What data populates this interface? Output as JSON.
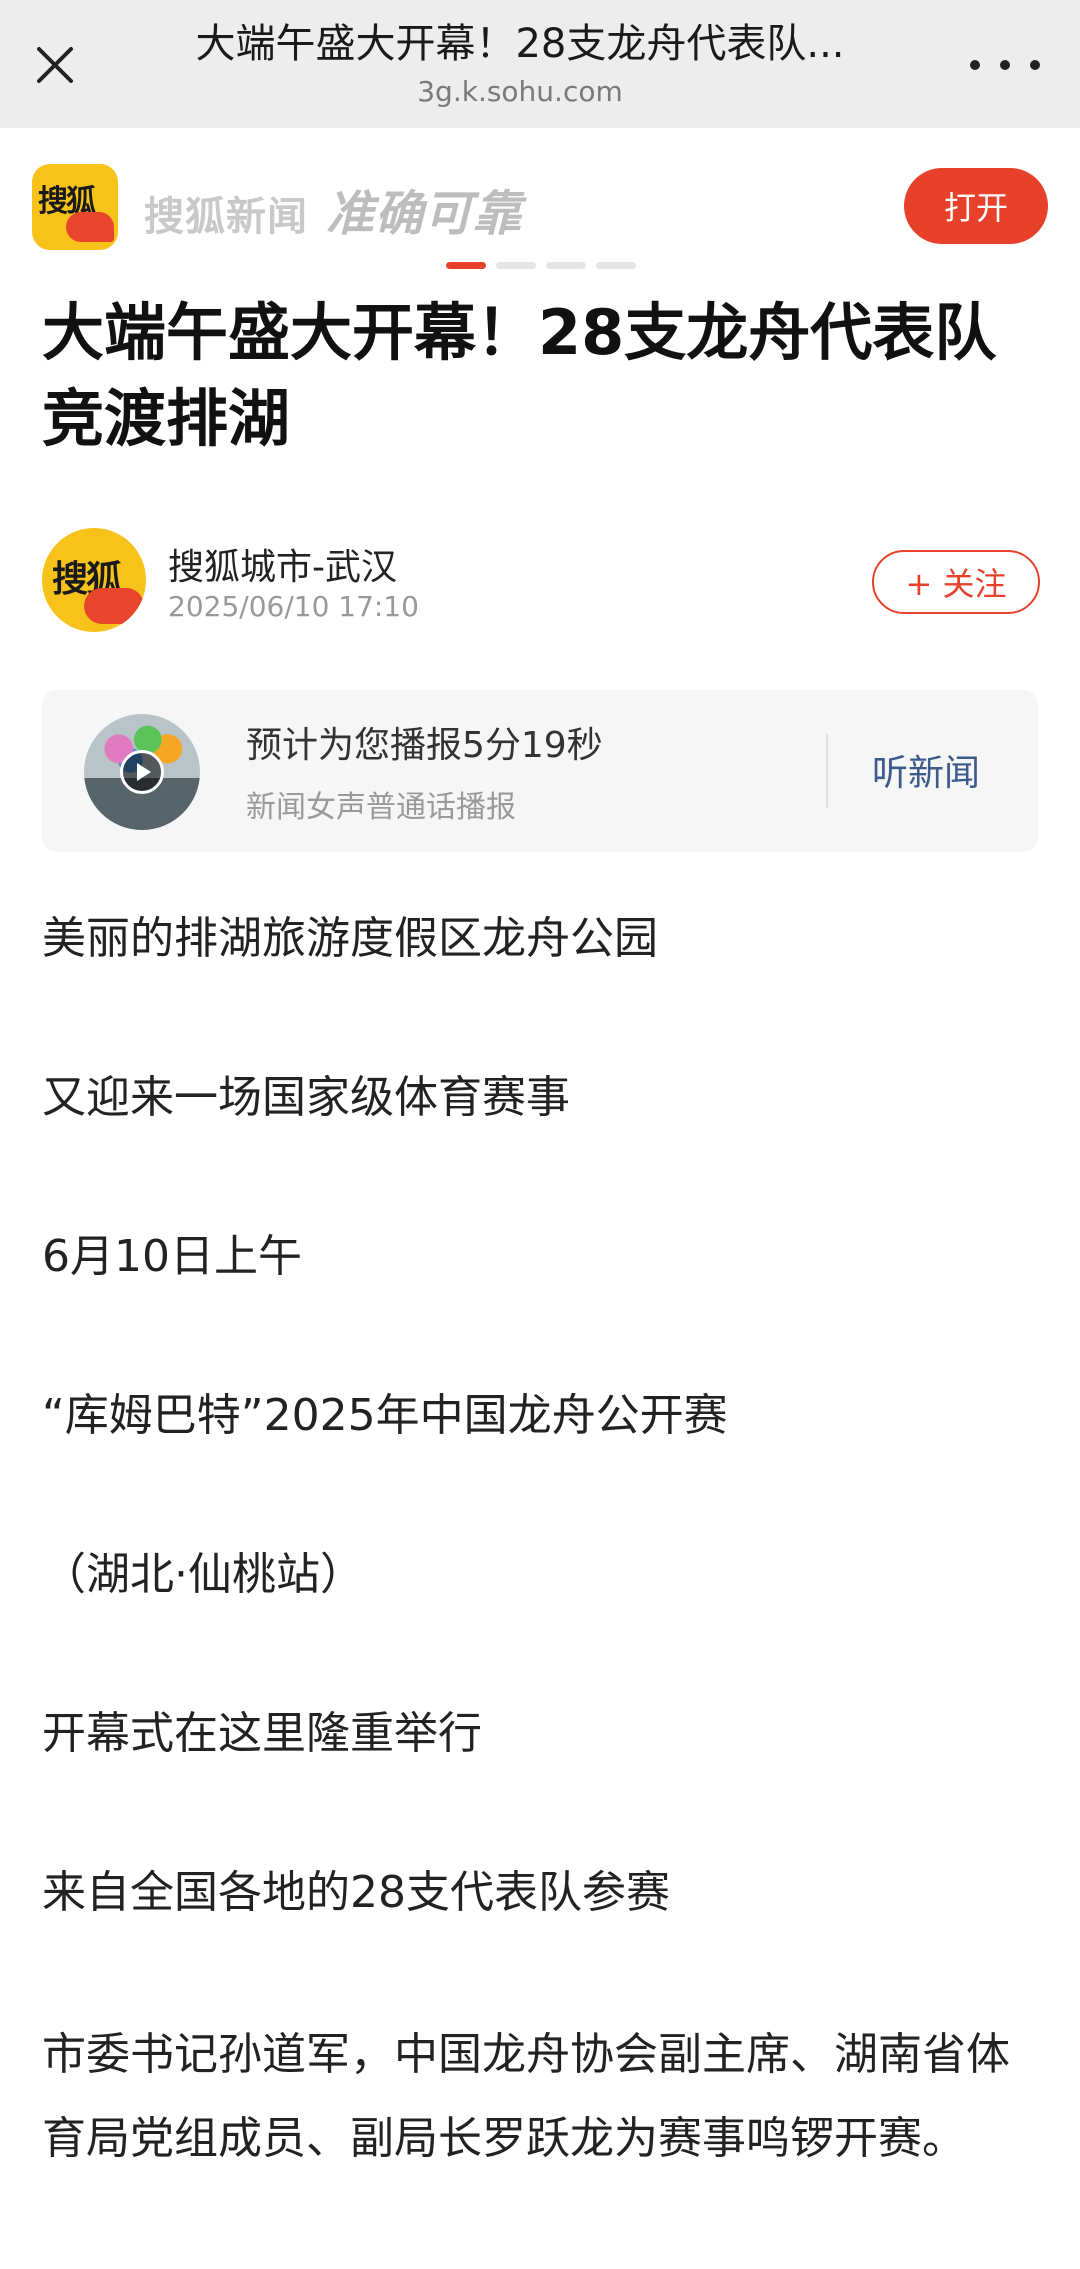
{
  "browser": {
    "title": "大端午盛大开幕！28支龙舟代表队...",
    "url": "3g.k.sohu.com"
  },
  "promo": {
    "logo_text": "搜狐",
    "app_name": "搜狐新闻",
    "slogan": "准确可靠",
    "open_label": "打开"
  },
  "article": {
    "headline": "大端午盛大开幕！28支龙舟代表队竞渡排湖",
    "author": {
      "name": "搜狐城市-武汉",
      "time": "2025/06/10 17:10",
      "avatar_text": "搜狐",
      "follow_label": "+ 关注"
    },
    "listen": {
      "main": "预计为您播报5分19秒",
      "sub": "新闻女声普通话播报",
      "button": "听新闻"
    },
    "paragraphs": [
      "美丽的排湖旅游度假区龙舟公园",
      "又迎来一场国家级体育赛事",
      "6月10日上午",
      "“库姆巴特”2025年中国龙舟公开赛",
      "（湖北·仙桃站）",
      "开幕式在这里隆重举行",
      "来自全国各地的28支代表队参赛",
      "市委书记孙道军，中国龙舟协会副主席、湖南省体育局党组成员、副局长罗跃龙为赛事鸣锣开赛。"
    ]
  },
  "colors": {
    "accent": "#e8412b",
    "link": "#3d5a8a",
    "logo_yellow": "#f7c21a"
  }
}
